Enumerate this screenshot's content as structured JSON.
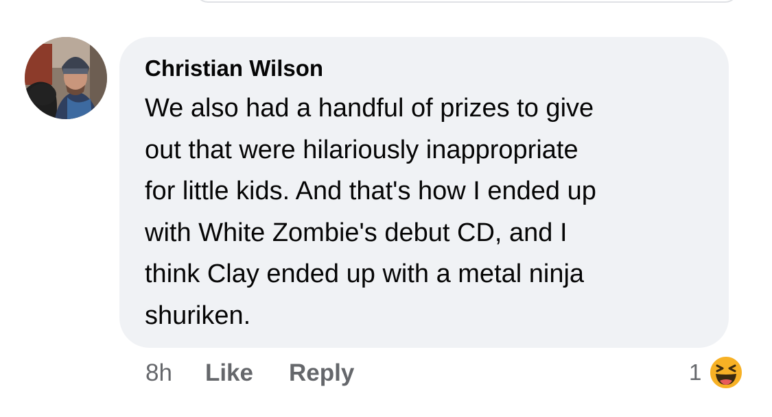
{
  "comment": {
    "author": "Christian Wilson",
    "text": "We also had a handful of prizes to give\nout that were hilariously inappropriate\nfor little kids. And that's how I ended up\nwith White Zombie's debut CD, and I\nthink Clay ended up with a metal ninja\nshuriken.",
    "timestamp": "8h",
    "like_label": "Like",
    "reply_label": "Reply",
    "reaction_count": "1",
    "reaction_icon": "haha-emoji-icon"
  },
  "colors": {
    "bubble_bg": "#f0f2f5",
    "text": "#050505",
    "secondary": "#65676b",
    "haha_yellow": "#f7b125"
  }
}
